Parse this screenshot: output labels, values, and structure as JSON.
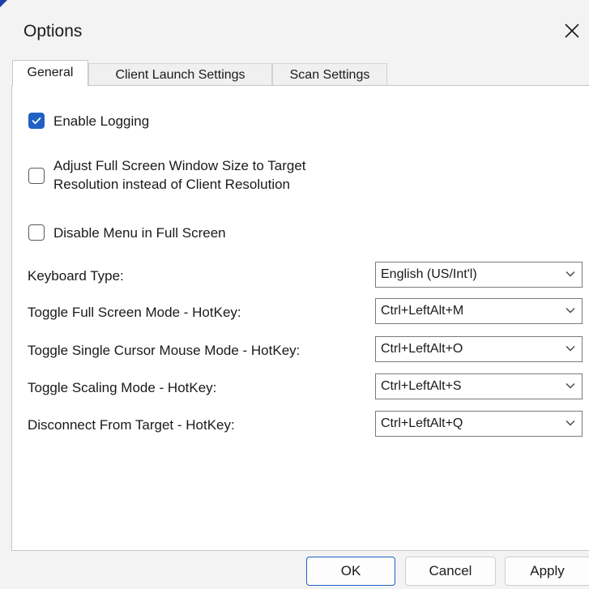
{
  "window": {
    "title": "Options"
  },
  "tabs": [
    {
      "label": "General",
      "active": true
    },
    {
      "label": "Client Launch Settings",
      "active": false
    },
    {
      "label": "Scan Settings",
      "active": false
    }
  ],
  "checkboxes": {
    "enable_logging": {
      "label": "Enable Logging",
      "checked": true
    },
    "adjust_full_screen": {
      "label_line1": "Adjust Full Screen Window Size to Target",
      "label_line2": "Resolution instead of Client Resolution",
      "checked": false
    },
    "disable_menu": {
      "label": "Disable Menu in Full Screen",
      "checked": false
    }
  },
  "settings": {
    "keyboard_type": {
      "label": "Keyboard Type:",
      "value": "English (US/Int'l)"
    },
    "toggle_full_screen": {
      "label": "Toggle Full Screen Mode - HotKey:",
      "value": "Ctrl+LeftAlt+M"
    },
    "toggle_single_cursor": {
      "label": "Toggle Single Cursor Mouse Mode - HotKey:",
      "value": "Ctrl+LeftAlt+O"
    },
    "toggle_scaling": {
      "label": "Toggle Scaling Mode - HotKey:",
      "value": "Ctrl+LeftAlt+S"
    },
    "disconnect": {
      "label": "Disconnect From Target - HotKey:",
      "value": "Ctrl+LeftAlt+Q"
    }
  },
  "buttons": {
    "ok": "OK",
    "cancel": "Cancel",
    "apply": "Apply"
  },
  "icons": {
    "close": "close-icon",
    "checkmark": "checkmark-icon",
    "dropdown": "chevron-down-icon"
  },
  "colors": {
    "accent": "#1f62c4",
    "window_bg": "#f3f3f3",
    "panel_bg": "#ffffff"
  }
}
